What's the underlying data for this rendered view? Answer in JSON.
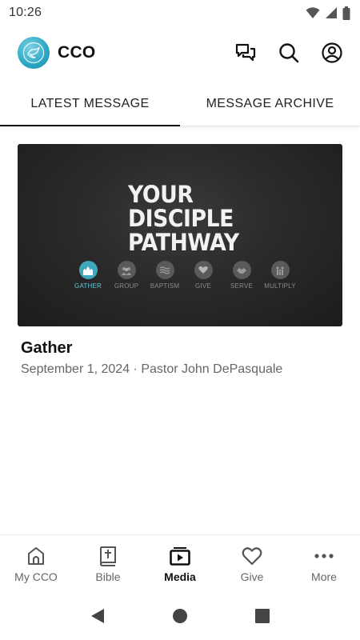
{
  "status_bar": {
    "time": "10:26",
    "icons": [
      "wifi-icon",
      "signal-icon",
      "battery-icon"
    ]
  },
  "header": {
    "app_name": "CCO",
    "logo_color": "#2aa6c2",
    "actions": [
      "chat-icon",
      "search-icon",
      "account-icon"
    ]
  },
  "tabs": [
    {
      "label": "LATEST MESSAGE",
      "active": true
    },
    {
      "label": "MESSAGE ARCHIVE",
      "active": false
    }
  ],
  "message": {
    "thumbnail": {
      "title_lines": [
        "YOUR",
        "DISCIPLE",
        "PATHWAY"
      ],
      "steps": [
        {
          "label": "GATHER",
          "icon": "church-icon",
          "active": true
        },
        {
          "label": "GROUP",
          "icon": "people-icon",
          "active": false
        },
        {
          "label": "BAPTISM",
          "icon": "waves-icon",
          "active": false
        },
        {
          "label": "GIVE",
          "icon": "heart-icon",
          "active": false
        },
        {
          "label": "SERVE",
          "icon": "handshake-icon",
          "active": false
        },
        {
          "label": "MULTIPLY",
          "icon": "family-icon",
          "active": false
        }
      ],
      "accent": "#3fa8bb"
    },
    "title": "Gather",
    "meta": "September 1, 2024 · Pastor John DePasquale"
  },
  "bottom_nav": [
    {
      "label": "My CCO",
      "icon": "church-home-icon",
      "active": false
    },
    {
      "label": "Bible",
      "icon": "bible-icon",
      "active": false
    },
    {
      "label": "Media",
      "icon": "media-icon",
      "active": true
    },
    {
      "label": "Give",
      "icon": "heart-icon",
      "active": false
    },
    {
      "label": "More",
      "icon": "more-icon",
      "active": false
    }
  ],
  "system_nav": [
    "back-icon",
    "home-icon",
    "recents-icon"
  ]
}
